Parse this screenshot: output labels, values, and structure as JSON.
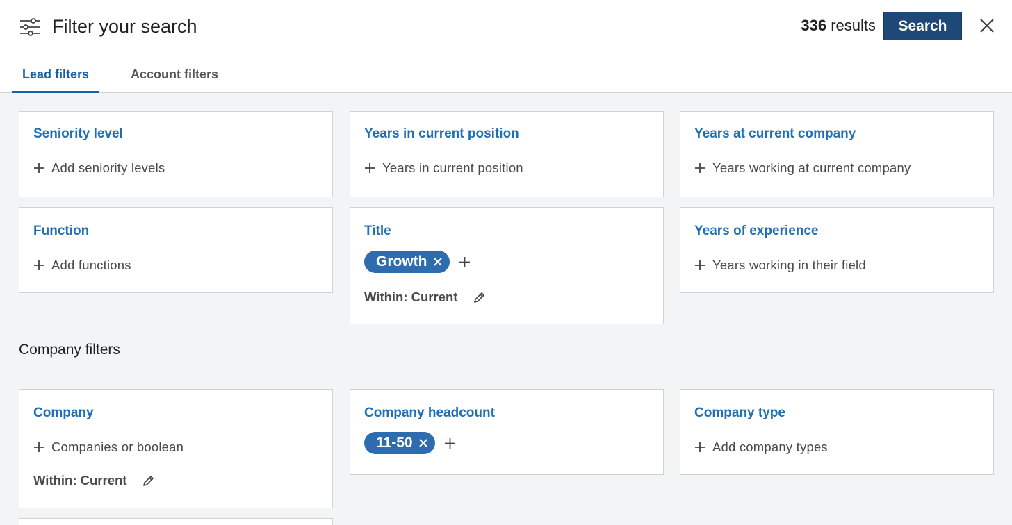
{
  "header": {
    "title": "Filter your search",
    "results_count": "336",
    "results_suffix": "results",
    "search_label": "Search"
  },
  "tabs": [
    {
      "label": "Lead filters",
      "active": true
    },
    {
      "label": "Account filters",
      "active": false
    }
  ],
  "lead_filters": {
    "seniority": {
      "title": "Seniority level",
      "placeholder": "Add seniority levels"
    },
    "years_position": {
      "title": "Years in current position",
      "placeholder": "Years in current position"
    },
    "years_company": {
      "title": "Years at current company",
      "placeholder": "Years working at current company"
    },
    "function": {
      "title": "Function",
      "placeholder": "Add functions"
    },
    "title": {
      "title": "Title",
      "pill": "Growth",
      "within": "Within: Current"
    },
    "experience": {
      "title": "Years of experience",
      "placeholder": "Years working in their field"
    }
  },
  "company_section_label": "Company filters",
  "company_filters": {
    "company": {
      "title": "Company",
      "placeholder": "Companies or boolean",
      "within": "Within: Current"
    },
    "headcount": {
      "title": "Company headcount",
      "pill": "11-50"
    },
    "type": {
      "title": "Company type",
      "placeholder": "Add company types"
    }
  },
  "colors": {
    "accent": "#1f6fb7",
    "pill": "#2e6cb0",
    "search_button": "#1d4878"
  },
  "icons": [
    "sliders-icon",
    "close-icon",
    "plus-icon",
    "pencil-icon"
  ]
}
